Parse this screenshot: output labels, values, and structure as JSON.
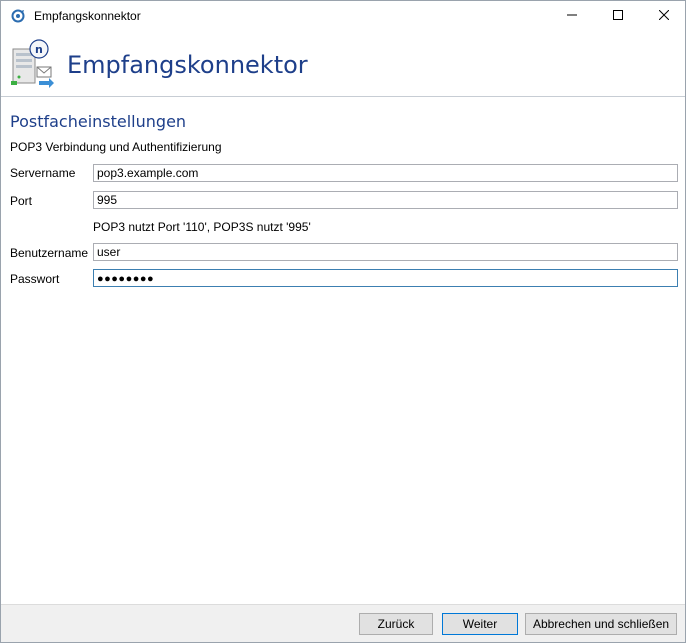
{
  "window": {
    "title": "Empfangskonnektor",
    "icon": "connector-app-icon",
    "controls": {
      "minimize_icon": "minimize-icon",
      "maximize_icon": "maximize-icon",
      "close_icon": "close-icon"
    }
  },
  "header": {
    "title": "Empfangskonnektor",
    "icon": "server-mail-connector-icon"
  },
  "section": {
    "title": "Postfacheinstellungen",
    "subtitle": "POP3 Verbindung und Authentifizierung"
  },
  "form": {
    "servername": {
      "label": "Servername",
      "value": "pop3.example.com"
    },
    "port": {
      "label": "Port",
      "value": "995",
      "hint": "POP3 nutzt Port '110', POP3S nutzt '995'"
    },
    "benutzername": {
      "label": "Benutzername",
      "value": "user"
    },
    "passwort": {
      "label": "Passwort",
      "masked_value": "●●●●●●●●"
    }
  },
  "footer": {
    "back_label": "Zurück",
    "next_label": "Weiter",
    "cancel_label": "Abbrechen und schließen"
  },
  "colors": {
    "accent_title": "#1e3f8a",
    "focus_border": "#3c7fb1",
    "default_button_border": "#0078d7"
  }
}
